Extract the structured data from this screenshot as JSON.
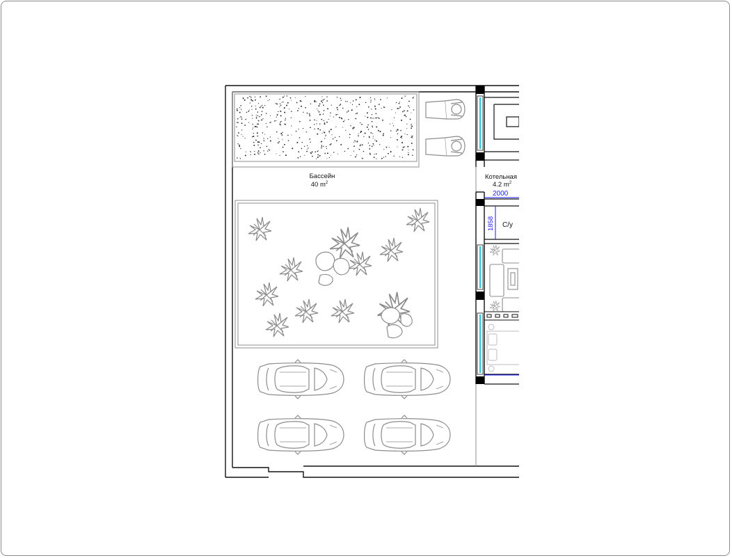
{
  "colors": {
    "wall": "#111111",
    "line": "#8c8c8c",
    "pool_dots": "#222222",
    "plant": "#8a8a8a",
    "window": "#22c4dc",
    "dimension": "#1a1aff",
    "column": "#000000"
  },
  "rooms": {
    "pool": {
      "name": "Бассейн",
      "area_value": "40 m",
      "area_unit_sup": "2"
    },
    "boiler": {
      "name": "Котельная",
      "area_value": "4.2 m",
      "area_unit_sup": "2"
    },
    "bathroom": {
      "name": "С/у"
    }
  },
  "dimensions": {
    "boiler_width": "2000",
    "bathroom_depth": "1858"
  },
  "icons": {
    "pool_texture": "dotted-hatch",
    "deck_chair": "sunbed-icon",
    "garden_plant": "plant-icon",
    "car": "car-icon",
    "sofa": "sofa-icon",
    "bed": "bed-icon"
  },
  "parking": {
    "car_count": 4
  },
  "garden": {
    "plant_count": 11
  }
}
